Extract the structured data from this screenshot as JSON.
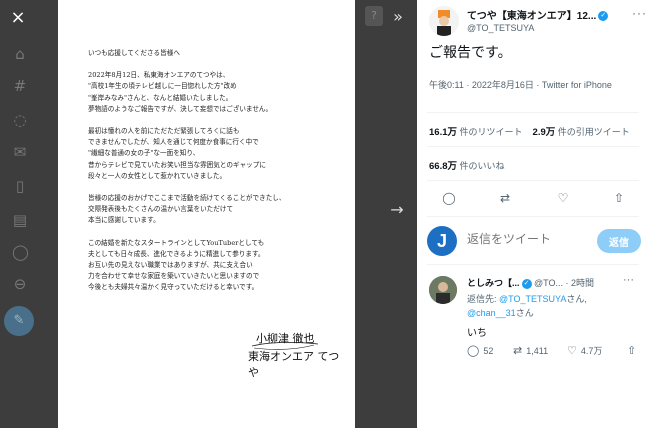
{
  "viewer": {
    "close_icon": "×",
    "collapse_icon": "»",
    "next_icon": "→"
  },
  "letter": {
    "paragraphs": [
      [
        "いつも応援してくださる皆様へ"
      ],
      [
        "2022年8月12日、私東海オンエアのてつやは、",
        "\"高校1年生の頃テレビ越しに一目惚れした方\"改め",
        "\"峯岸みなみ\"さんと、なんと結婚いたしました。",
        "夢物語のようなご報告ですが、決して妄想ではございません。"
      ],
      [
        "最初は憧れの人を前にただただ緊張してろくに話も",
        "できませんでしたが、知人を通じて何度か食事に行く中で",
        "\"繊細な普通の女の子\"な一面を知り、",
        "昔からテレビで見ていたお笑い担当な雰囲気とのギャップに",
        "段々と一人の女性として惹かれていきました。"
      ],
      [
        "皆様の応援のおかげでここまで活動を続けてくることができたし、",
        "交際発表後もたくさんの温かい言葉をいただけて",
        "本当に感謝しています。"
      ],
      [
        "この結婚を新たなスタートラインとしてYouTuberとしても",
        "夫としても日々成長、進化できるように精進して参ります。",
        "お互い先の見えない職業ではありますが、共に支え合い",
        "力を合わせて幸せな家庭を築いていきたいと思いますので",
        "今後とも夫婦共々温かく見守っていただけると幸いです。"
      ]
    ],
    "signature_line1": "小柳津 徹也",
    "signature_line2": "東海オンエア てつや"
  },
  "tweet": {
    "author_name": "てつや【東海オンエア】12...",
    "handle": "@TO_TETSUYA",
    "text": "ご報告です。",
    "time": "午後0:11 · 2022年8月16日 · Twitter for iPhone",
    "retweets_count": "16.1万",
    "retweets_label": "件のリツイート",
    "quotes_count": "2.9万",
    "quotes_label": "件の引用ツイート",
    "likes_count": "66.8万",
    "likes_label": "件のいいね"
  },
  "reply_box": {
    "placeholder": "返信をツイート",
    "button": "返信"
  },
  "reply": {
    "name": "としみつ【...",
    "handle": "@TO...",
    "time": "2時間",
    "to_prefix": "返信先: ",
    "to_user1": "@TO_TETSUYA",
    "to_mid": "さん,",
    "to_user2": "@chan__31",
    "to_suffix": "さん",
    "text": "いち",
    "replies": "52",
    "retweets": "1,411",
    "likes": "4.7万"
  },
  "icons": {
    "comment": "comment-icon",
    "retweet": "retweet-icon",
    "like": "heart-icon",
    "share": "share-icon"
  },
  "colors": {
    "accent": "#1d9bf0",
    "reply_button": "#8ecdf8",
    "viewer_bg": "#3d3d3d"
  }
}
